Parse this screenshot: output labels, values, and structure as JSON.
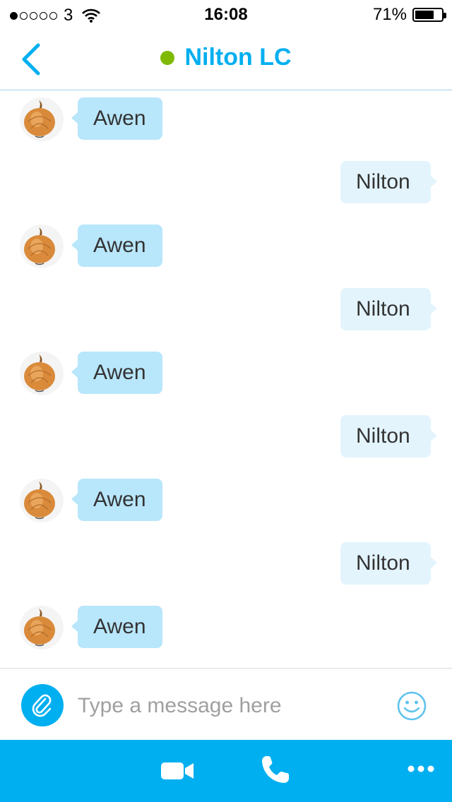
{
  "status_bar": {
    "carrier": "3",
    "time": "16:08",
    "battery": "71%",
    "battery_level": 0.71,
    "signal_bars": 1,
    "signal_total": 5
  },
  "header": {
    "title": "Nilton LC",
    "presence_color": "#7fba00",
    "accent_color": "#00aff0"
  },
  "messages": [
    {
      "from": "them",
      "text": "Awen"
    },
    {
      "from": "me",
      "text": "Nilton"
    },
    {
      "from": "them",
      "text": "Awen"
    },
    {
      "from": "me",
      "text": "Nilton"
    },
    {
      "from": "them",
      "text": "Awen"
    },
    {
      "from": "me",
      "text": "Nilton"
    },
    {
      "from": "them",
      "text": "Awen"
    },
    {
      "from": "me",
      "text": "Nilton"
    },
    {
      "from": "them",
      "text": "Awen"
    }
  ],
  "composer": {
    "placeholder": "Type a message here"
  },
  "icons": {
    "back": "chevron-left-icon",
    "attach": "paperclip-icon",
    "emoji": "smiley-icon",
    "video": "video-camera-icon",
    "call": "phone-icon",
    "more": "more-dots-icon"
  }
}
